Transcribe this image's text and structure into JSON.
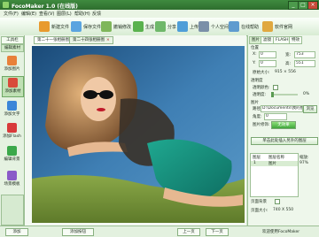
{
  "window": {
    "title": "FocoMaker 1.0 (在线版)",
    "btn_min": "_",
    "btn_max": "□",
    "btn_close": "×"
  },
  "menu": [
    "文件(F)",
    "编辑(E)",
    "查看(V)",
    "图层(L)",
    "帮助(H)",
    "反馈"
  ],
  "toolbar": [
    {
      "label": "新建文件",
      "icon": "new-icon",
      "color": "#e89a2e"
    },
    {
      "label": "保存文件",
      "icon": "save-icon",
      "color": "#5aa4e0"
    },
    {
      "label": "撤销修改",
      "icon": "undo-icon",
      "color": "#7fb65a"
    },
    {
      "label": "生成",
      "icon": "generate-icon",
      "color": "#5ab24e"
    },
    {
      "label": "分享",
      "icon": "share-icon",
      "color": "#6fb86a"
    },
    {
      "label": "上传",
      "icon": "upload-icon",
      "color": "#4f9ed8"
    },
    {
      "label": "个人空间",
      "icon": "user-icon",
      "color": "#7a8fa8"
    },
    {
      "label": "在线帮助",
      "icon": "help-icon",
      "color": "#5f9bcf"
    },
    {
      "label": "软件官网",
      "icon": "home-icon",
      "color": "#e0a840"
    }
  ],
  "leftnav": {
    "tab_tools": "工具栏",
    "tab_edit": "编辑素材",
    "items": [
      {
        "label": "添加图片",
        "icon": "add-image-icon",
        "color": "#e8803a"
      },
      {
        "label": "添加素材",
        "icon": "add-material-icon",
        "color": "#d84a3a"
      },
      {
        "label": "添加文字",
        "icon": "add-text-icon",
        "color": "#3a86d8"
      },
      {
        "label": "添加Flash",
        "icon": "add-flash-icon",
        "color": "#d83a3a"
      },
      {
        "label": "编辑背景",
        "icon": "background-icon",
        "color": "#3aa84a"
      },
      {
        "label": "场景模板",
        "icon": "template-icon",
        "color": "#8a5ac8"
      }
    ]
  },
  "tabs": [
    {
      "label": "第二十一张相册图",
      "close": "×"
    },
    {
      "label": "第二十四张相册图",
      "close": "×"
    }
  ],
  "props": {
    "tabs": [
      "图片",
      "滤镜",
      "FLASH",
      "特效"
    ],
    "pos_label": "位置",
    "x_label": "X:",
    "x_value": "0",
    "y_label": "Y:",
    "y_value": "0",
    "w_label": "宽:",
    "w_value": "753",
    "h_label": "高:",
    "h_value": "551",
    "size_label": "原始大小:",
    "size_value": "915 × 556",
    "alpha_title": "透明度",
    "alpha_color_label": "透明颜色:",
    "alpha_label": "透明度:",
    "alpha_value": "0%",
    "image_title": "图片",
    "path_label": "路径:",
    "path_value": "D:\\Documents\\我的图",
    "path_btn": "浏览",
    "rotate_label": "角度:",
    "rotate_value": "0",
    "fit_label": "图片修饰:",
    "fit_btn": "无效果",
    "action_btn": "单击此处插入另外的图层",
    "layers_header": [
      "图层",
      "图层名称"
    ],
    "layers": [
      {
        "num": "1",
        "name": "图片"
      }
    ],
    "zoom_label": "缩放:",
    "zoom_value": "97%",
    "page_label": "页面背景",
    "page_size_label": "页面大小:",
    "page_size_value": "740 X 550"
  },
  "status": {
    "btn1": "添加",
    "btn2": "添加按钮",
    "btn3": "上一页",
    "btn4": "下一页",
    "welcome": "欢迎使用FocoMaker"
  }
}
